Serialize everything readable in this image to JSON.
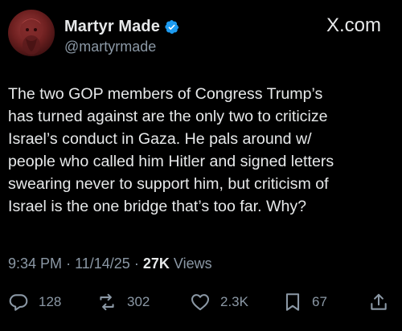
{
  "author": {
    "display_name": "Martyr Made",
    "handle": "@martyrmade",
    "verified": true
  },
  "site": "X.com",
  "post": {
    "text": "The two GOP members of Congress Trump’s\nhas turned against are the only two to criticize\nIsrael’s conduct in Gaza. He pals around w/\npeople who called him Hitler and signed letters\nswearing never to support him, but criticism of\nIsrael is the one bridge that’s too far. Why?"
  },
  "meta": {
    "time": "9:34 PM",
    "separator": "·",
    "date": "11/14/25",
    "views_count": "27K",
    "views_label": "Views"
  },
  "actions": {
    "replies": "128",
    "reposts": "302",
    "likes": "2.3K",
    "bookmarks": "67"
  },
  "colors": {
    "background": "#000000",
    "text": "#e7e9ea",
    "muted": "#8b98a5",
    "verified": "#1d9bf0"
  },
  "icons": [
    "avatar",
    "verified-badge-icon",
    "reply-icon",
    "repost-icon",
    "like-icon",
    "bookmark-icon",
    "share-icon"
  ]
}
